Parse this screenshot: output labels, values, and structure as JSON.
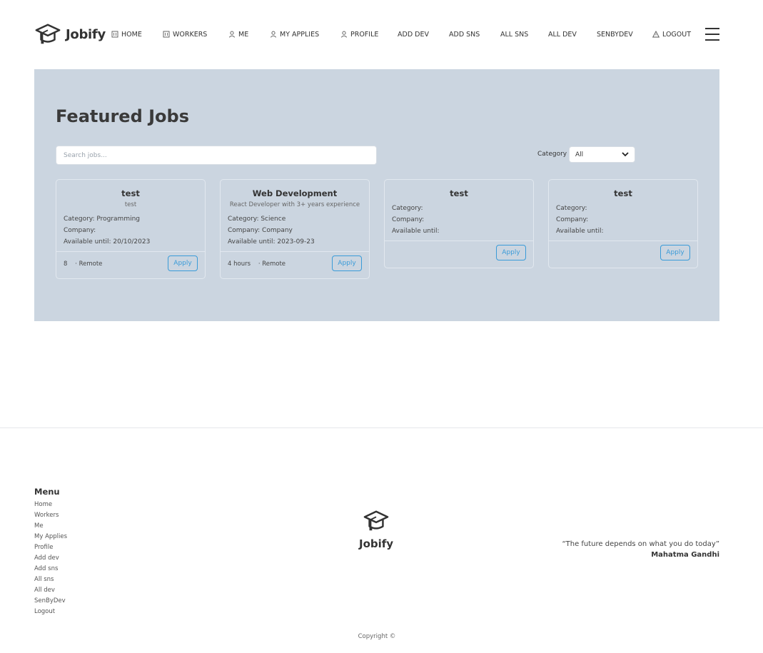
{
  "app": {
    "name": "Jobify"
  },
  "nav": [
    {
      "label": "HOME",
      "icon": "building-icon"
    },
    {
      "label": "WORKERS",
      "icon": "building-icon"
    },
    {
      "label": "ME",
      "icon": "user-icon"
    },
    {
      "label": "MY APPLIES",
      "icon": "user-icon"
    },
    {
      "label": "PROFILE",
      "icon": "user-icon"
    },
    {
      "label": "ADD DEV",
      "icon": ""
    },
    {
      "label": "ADD SNS",
      "icon": ""
    },
    {
      "label": "ALL SNS",
      "icon": ""
    },
    {
      "label": "ALL DEV",
      "icon": ""
    },
    {
      "label": "SENBYDEV",
      "icon": ""
    },
    {
      "label": "LOGOUT",
      "icon": "warning-icon"
    }
  ],
  "hero": {
    "title": "Featured Jobs",
    "search_placeholder": "Search jobs...",
    "category_label": "Category",
    "category_selected": "All"
  },
  "cards": [
    {
      "title": "test",
      "subtitle": "test",
      "category": "Category: Programming",
      "company": "Company:",
      "available": "Available until: 20/10/2023",
      "meta": "8    · Remote",
      "apply": "Apply"
    },
    {
      "title": "Web Development",
      "subtitle": "React Developer with 3+ years experience",
      "category": "Category: Science",
      "company": "Company: Company",
      "available": "Available until: 2023-09-23",
      "meta": "4 hours    · Remote",
      "apply": "Apply"
    },
    {
      "title": "test",
      "subtitle": "",
      "category": "Category:",
      "company": "Company:",
      "available": "Available until:",
      "meta": "",
      "apply": "Apply"
    },
    {
      "title": "test",
      "subtitle": "",
      "category": "Category:",
      "company": "Company:",
      "available": "Available until:",
      "meta": "",
      "apply": "Apply"
    }
  ],
  "footer": {
    "menu_title": "Menu",
    "links": [
      "Home",
      "Workers",
      "Me",
      "My Applies",
      "Profile",
      "Add dev",
      "Add sns",
      "All sns",
      "All dev",
      "SenByDev",
      "Logout"
    ],
    "logo_text": "Jobify",
    "quote": "“The future depends on what you do today”",
    "quote_author": "Mahatma Gandhi",
    "copyright": "Copyright ©"
  }
}
